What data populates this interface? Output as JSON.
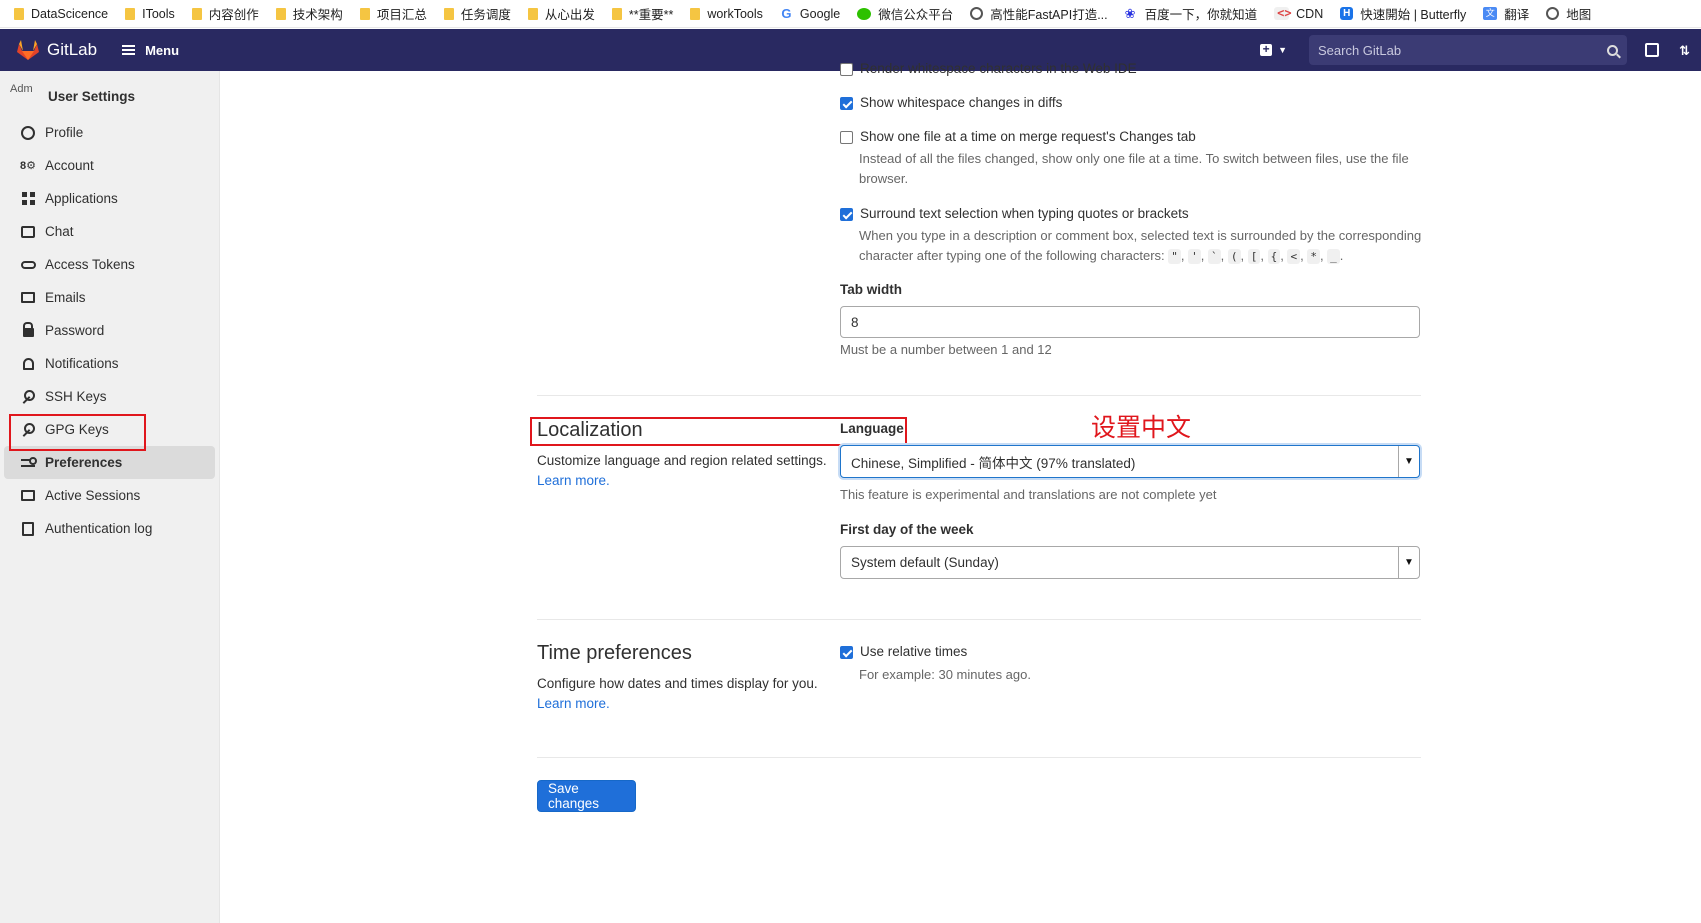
{
  "bookmarks": [
    {
      "label": "DataScicence",
      "icon": "folder-icon"
    },
    {
      "label": "ITools",
      "icon": "folder-icon"
    },
    {
      "label": "内容创作",
      "icon": "folder-icon"
    },
    {
      "label": "技术架构",
      "icon": "folder-icon"
    },
    {
      "label": "项目汇总",
      "icon": "folder-icon"
    },
    {
      "label": "任务调度",
      "icon": "folder-icon"
    },
    {
      "label": "从心出发",
      "icon": "folder-icon"
    },
    {
      "label": "**重要**",
      "icon": "folder-icon"
    },
    {
      "label": "workTools",
      "icon": "folder-icon"
    },
    {
      "label": "Google",
      "icon": "google-icon"
    },
    {
      "label": "微信公众平台",
      "icon": "wechat-icon"
    },
    {
      "label": "高性能FastAPI打造...",
      "icon": "globe-icon"
    },
    {
      "label": "百度一下，你就知道",
      "icon": "baidu-icon"
    },
    {
      "label": "CDN",
      "icon": "code-icon"
    },
    {
      "label": "快速開始 | Butterfly",
      "icon": "butterfly-icon"
    },
    {
      "label": "翻译",
      "icon": "translate-icon"
    },
    {
      "label": "地图",
      "icon": "globe-icon"
    }
  ],
  "topnav": {
    "brand": "GitLab",
    "menu_label": "Menu",
    "search_placeholder": "Search GitLab",
    "brand_color": "#292961"
  },
  "sidebar": {
    "avatar_alt": "Adm",
    "title": "User Settings",
    "items": [
      {
        "label": "Profile",
        "icon": "profile-icon"
      },
      {
        "label": "Account",
        "icon": "account-icon"
      },
      {
        "label": "Applications",
        "icon": "applications-icon"
      },
      {
        "label": "Chat",
        "icon": "chat-icon"
      },
      {
        "label": "Access Tokens",
        "icon": "token-icon"
      },
      {
        "label": "Emails",
        "icon": "mail-icon"
      },
      {
        "label": "Password",
        "icon": "lock-icon"
      },
      {
        "label": "Notifications",
        "icon": "bell-icon"
      },
      {
        "label": "SSH Keys",
        "icon": "key-icon"
      },
      {
        "label": "GPG Keys",
        "icon": "key-icon"
      },
      {
        "label": "Preferences",
        "icon": "preferences-icon",
        "active": true
      },
      {
        "label": "Active Sessions",
        "icon": "monitor-icon"
      },
      {
        "label": "Authentication log",
        "icon": "log-icon"
      }
    ]
  },
  "behavior": {
    "render_whitespace": {
      "label": "Render whitespace characters in the Web IDE",
      "checked": false
    },
    "show_whitespace": {
      "label": "Show whitespace changes in diffs",
      "checked": true
    },
    "one_file": {
      "label": "Show one file at a time on merge request's Changes tab",
      "checked": false,
      "help": "Instead of all the files changed, show only one file at a time. To switch between files, use the file browser."
    },
    "surround": {
      "label": "Surround text selection when typing quotes or brackets",
      "checked": true,
      "help_1": "When you type in a description or comment box, selected text is surrounded by the corresponding",
      "help_2": "character after typing one of the following characters:",
      "chars": [
        "\"",
        "'",
        "`",
        "(",
        "[",
        "{",
        "<",
        "*",
        "_"
      ]
    },
    "tab_width": {
      "label": "Tab width",
      "value": "8",
      "help": "Must be a number between 1 and 12"
    }
  },
  "localization": {
    "title": "Localization",
    "desc": "Customize language and region related settings.",
    "learn_more": "Learn more.",
    "language_label": "Language",
    "language_value": "Chinese, Simplified - 简体中文 (97% translated)",
    "language_help": "This feature is experimental and translations are not complete yet",
    "first_day_label": "First day of the week",
    "first_day_value": "System default (Sunday)",
    "annotation": "设置中文",
    "annotation_color": "#e0161c"
  },
  "time_prefs": {
    "title": "Time preferences",
    "desc": "Configure how dates and times display for you.",
    "learn_more": "Learn more.",
    "relative": {
      "label": "Use relative times",
      "checked": true,
      "help": "For example: 30 minutes ago."
    }
  },
  "save_button": "Save changes"
}
